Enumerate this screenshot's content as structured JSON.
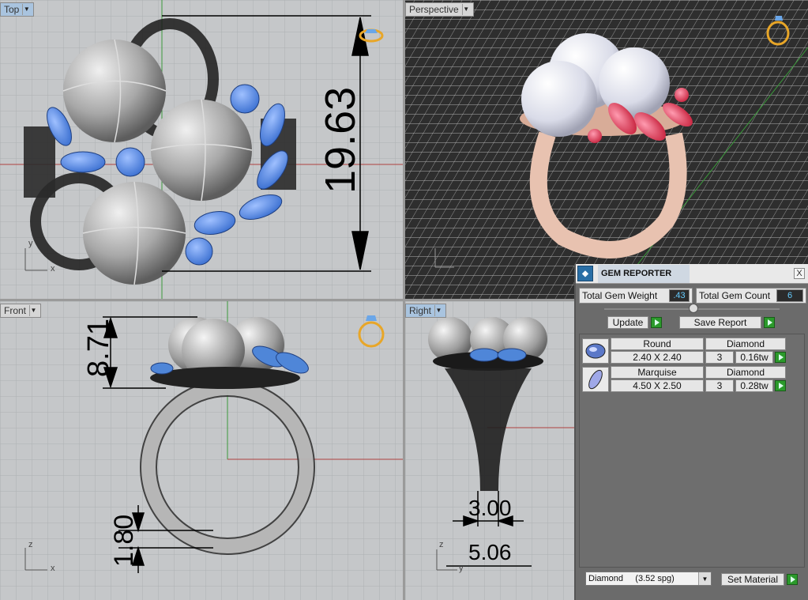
{
  "viewports": {
    "top": {
      "label": "Top",
      "dim_height": "19.63",
      "axis_y": "y",
      "axis_x": "x"
    },
    "perspective": {
      "label": "Perspective",
      "axis_y": "y",
      "axis_x": "x"
    },
    "front": {
      "label": "Front",
      "dim_top": "8.71",
      "dim_bottom": "1.80",
      "axis_y": "z",
      "axis_x": "x"
    },
    "right": {
      "label": "Right",
      "dim_inner": "3.00",
      "dim_outer": "5.06",
      "axis_y": "z",
      "axis_x": "y"
    }
  },
  "gem_reporter": {
    "title": "GEM REPORTER",
    "close": "X",
    "total_weight_label": "Total Gem Weight",
    "total_weight_value": ".43",
    "total_count_label": "Total Gem Count",
    "total_count_value": "6",
    "update_label": "Update",
    "save_report_label": "Save Report",
    "gems": [
      {
        "shape": "Round",
        "material": "Diamond",
        "size": "2.40 X 2.40",
        "count": "3",
        "weight": "0.16tw"
      },
      {
        "shape": "Marquise",
        "material": "Diamond",
        "size": "4.50 X 2.50",
        "count": "3",
        "weight": "0.28tw"
      }
    ],
    "material_select": "Diamond     (3.52 spg)",
    "set_material_label": "Set Material"
  },
  "colors": {
    "viewport_bg": "#c5c7c9",
    "perspective_bg": "#3a3a3a",
    "gem_blue": "#4f86d8",
    "pearl": "#e8eaf2",
    "ruby": "#e0435f",
    "metal_rose": "#e8c2b0",
    "accent_green": "#2b9a2b"
  }
}
